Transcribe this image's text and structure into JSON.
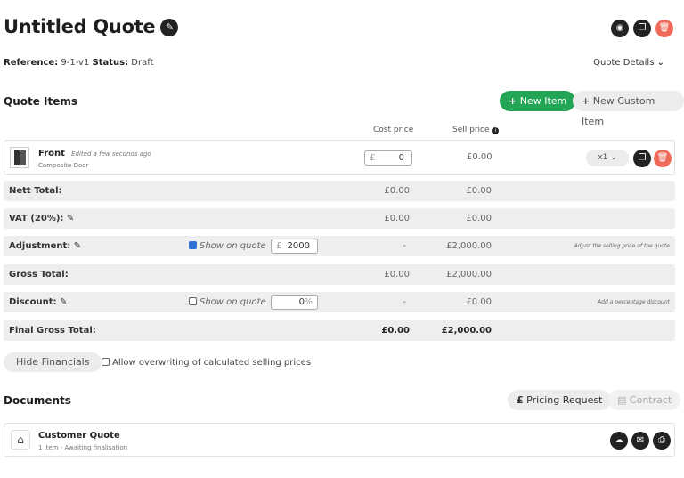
{
  "header": {
    "title": "Untitled Quote",
    "reference_label": "Reference:",
    "reference_value": "9-1-v1",
    "status_label": "Status:",
    "status_value": "Draft",
    "quote_details_label": "Quote Details"
  },
  "items_section": {
    "title": "Quote Items",
    "new_item_label": "New Item",
    "new_custom_item_label": "New Custom Item",
    "col_cost": "Cost price",
    "col_sell": "Sell price"
  },
  "item": {
    "name": "Front",
    "edited": "Edited a few seconds ago",
    "type": "Composite Door",
    "cost_prefix": "£",
    "cost_value": "0",
    "sell_price": "£0.00",
    "qty": "x1"
  },
  "totals": {
    "nett": {
      "label": "Nett Total:",
      "cost": "£0.00",
      "sell": "£0.00"
    },
    "vat": {
      "label": "VAT (20%):",
      "cost": "£0.00",
      "sell": "£0.00"
    },
    "adjustment": {
      "label": "Adjustment:",
      "show": "Show on quote",
      "prefix": "£",
      "value": "2000",
      "cost": "-",
      "sell": "£2,000.00",
      "note": "Adjust the selling price of the quote"
    },
    "gross": {
      "label": "Gross Total:",
      "cost": "£0.00",
      "sell": "£2,000.00"
    },
    "discount": {
      "label": "Discount:",
      "show": "Show on quote",
      "value": "0",
      "suffix": "%",
      "cost": "-",
      "sell": "£0.00",
      "note": "Add a percentage discount"
    },
    "final": {
      "label": "Final Gross Total:",
      "cost": "£0.00",
      "sell": "£2,000.00"
    }
  },
  "financials": {
    "hide_label": "Hide Financials",
    "allow_label": "Allow overwriting of calculated selling prices"
  },
  "documents": {
    "title": "Documents",
    "pricing_request_label": "Pricing Request",
    "contract_label": "Contract",
    "doc_title": "Customer Quote",
    "doc_sub": "1 item - Awaiting finalisation"
  },
  "colors": {
    "green": "#22a655",
    "red": "#f06a5a",
    "blue": "#2e6fd8"
  }
}
